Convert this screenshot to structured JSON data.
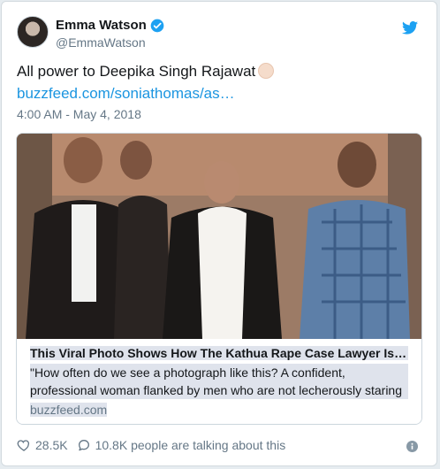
{
  "author": {
    "name": "Emma Watson",
    "handle": "@EmmaWatson"
  },
  "tweet": {
    "text": "All power to Deepika Singh Rajawat",
    "link": "buzzfeed.com/soniathomas/as…",
    "timestamp": "4:00 AM - May 4, 2018"
  },
  "card": {
    "title": "This Viral Photo Shows How The Kathua Rape Case Lawyer Is…",
    "description": "\"How often do we see a photograph like this? A confident, professional woman flanked by men who are not lecherously staring",
    "domain": "buzzfeed.com"
  },
  "engagement": {
    "likes": "28.5K",
    "talking": "10.8K people are talking about this"
  },
  "colors": {
    "link": "#1b95e0",
    "verified": "#1da1f2",
    "muted": "#657786",
    "text": "#14171a"
  },
  "icons": [
    "avatar",
    "verified-badge-icon",
    "twitter-bird-icon",
    "raised-hand-emoji",
    "heart-icon",
    "reply-bubble-icon",
    "info-icon"
  ]
}
